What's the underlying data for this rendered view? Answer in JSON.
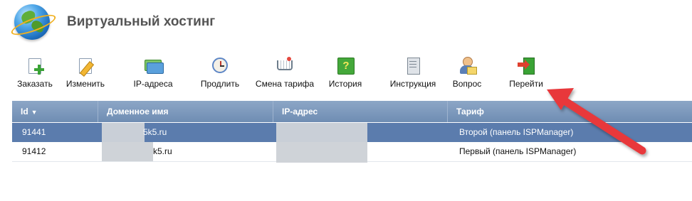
{
  "header": {
    "title": "Виртуальный хостинг"
  },
  "toolbar": {
    "buttons": [
      {
        "label": "Заказать",
        "icon": "new-document-icon"
      },
      {
        "label": "Изменить",
        "icon": "edit-icon"
      },
      {
        "label": "IP-адреса",
        "icon": "ip-addresses-icon"
      },
      {
        "label": "Продлить",
        "icon": "clock-icon"
      },
      {
        "label": "Смена тарифа",
        "icon": "cart-icon"
      },
      {
        "label": "История",
        "icon": "help-icon"
      },
      {
        "label": "Инструкция",
        "icon": "book-icon"
      },
      {
        "label": "Вопрос",
        "icon": "person-mail-icon"
      },
      {
        "label": "Перейти",
        "icon": "enter-door-icon"
      }
    ]
  },
  "table": {
    "columns": [
      "Id",
      "Доменное имя",
      "IP-адрес",
      "Тариф"
    ],
    "sort_indicator": "▼",
    "rows": [
      {
        "id": "91441",
        "domain": "5k5.ru",
        "ip": "",
        "tariff": "Второй (панель ISPManager)",
        "selected": true
      },
      {
        "id": "91412",
        "domain": "k5.ru",
        "ip": "",
        "tariff": "Первый (панель ISPManager)",
        "selected": false
      }
    ]
  },
  "colors": {
    "header_bar": "#7a96bb",
    "selected_row": "#5b7cad",
    "arrow": "#e8373a"
  }
}
